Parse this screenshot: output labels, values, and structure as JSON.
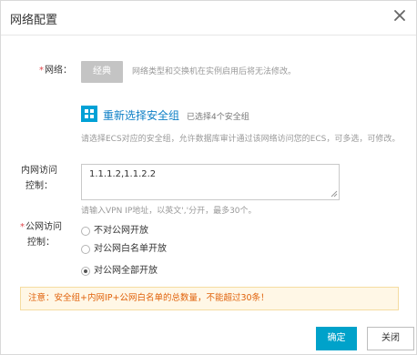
{
  "dialog": {
    "title": "网络配置",
    "close_icon": "close-icon"
  },
  "network": {
    "label": "网络：",
    "button_label": "经典",
    "hint": "网络类型和交换机在实例启用后将无法修改。"
  },
  "security_group": {
    "icon": "grid-icon",
    "reselect_label": "重新选择安全组",
    "selected_count": "已选择4个安全组",
    "hint": "请选择ECS对应的安全组，允许数据库审计通过该网络访问您的ECS，可多选，可修改。"
  },
  "intranet": {
    "label_line1": "内网访问",
    "label_line2": "控制：",
    "value": "1.1.1.2,1.1.2.2",
    "hint": "请输入VPN IP地址，以英文','分开，最多30个。"
  },
  "public": {
    "label_line1": "公网访问",
    "label_line2": "控制：",
    "options": [
      {
        "label": "不对公网开放",
        "selected": false
      },
      {
        "label": "对公网白名单开放",
        "selected": false
      },
      {
        "label": "对公网全部开放",
        "selected": true
      }
    ]
  },
  "notice": "注意：安全组+内网IP+公网白名单的总数量，不能超过30条！",
  "footer": {
    "confirm_label": "确定",
    "close_label": "关闭"
  },
  "colors": {
    "accent": "#00a2ca",
    "link": "#0d7fc6",
    "required": "#e0484d",
    "notice_text": "#e0620b",
    "notice_bg": "#fff7e6"
  }
}
